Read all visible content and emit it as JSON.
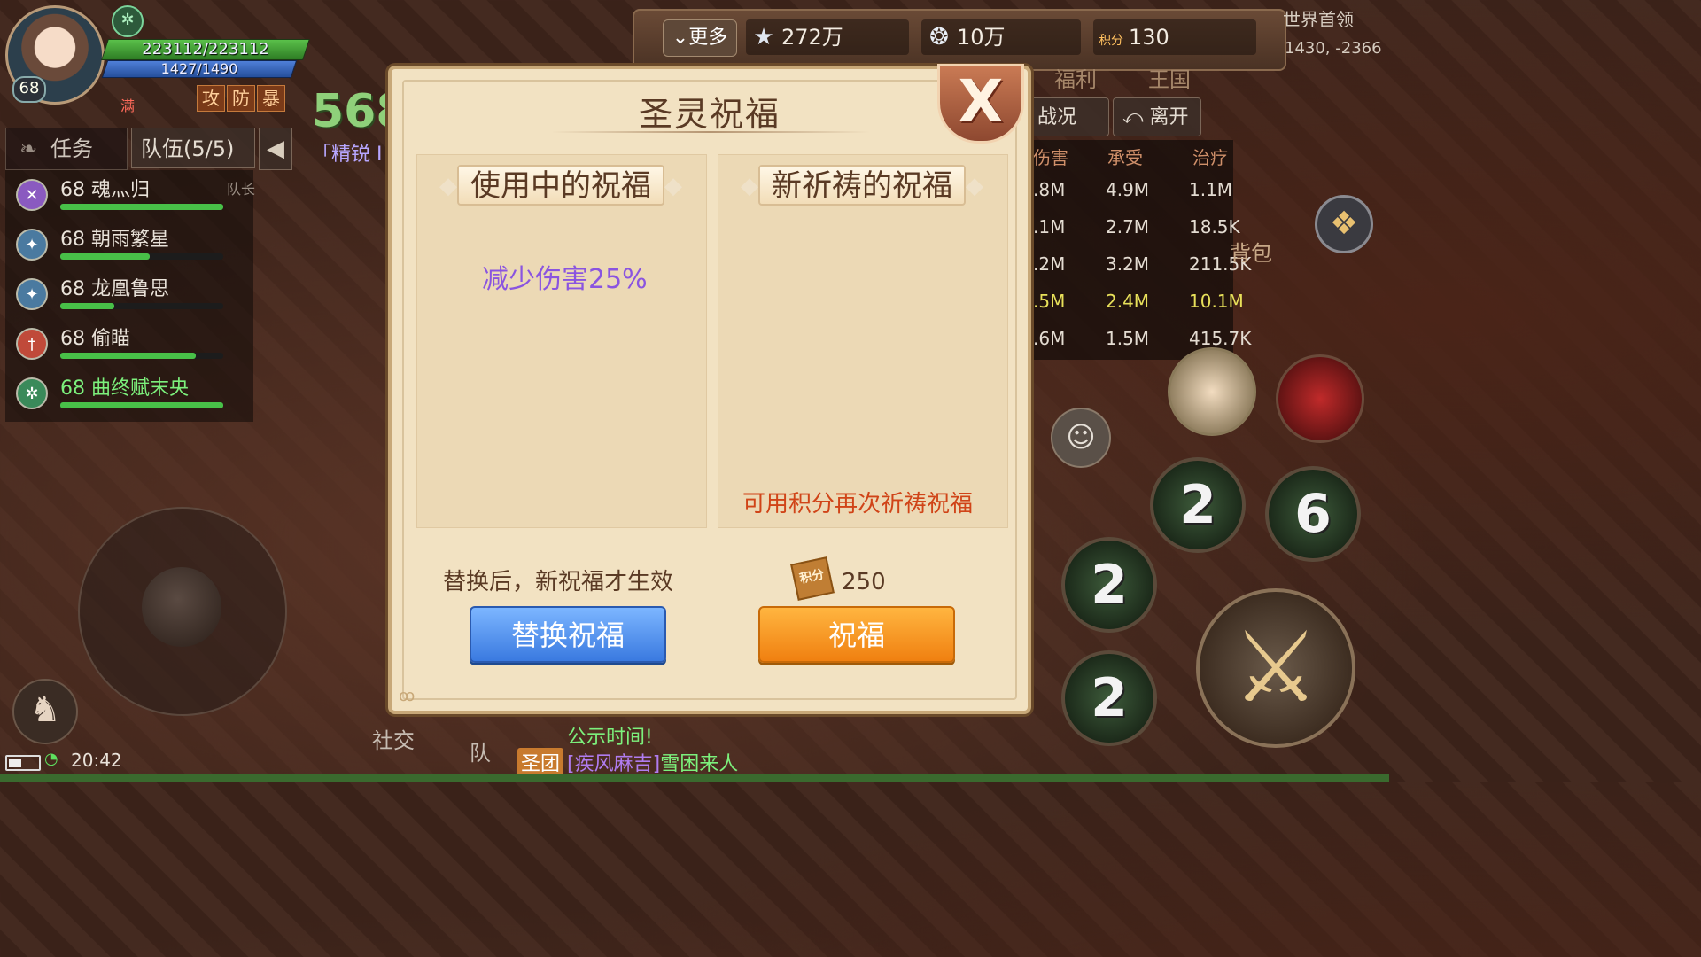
{
  "player": {
    "level": "68",
    "hp": "223112/223112",
    "mp": "1427/1490",
    "full_tag": "满",
    "stat_tags": [
      "攻",
      "防",
      "暴"
    ]
  },
  "left_tabs": {
    "task_label": "任务",
    "team_label": "队伍(5/5)"
  },
  "team": {
    "leader_tag": "队长",
    "members": [
      {
        "name": "68 魂灬归",
        "hp": 1.0,
        "color": "#8a5ac0"
      },
      {
        "name": "68 朝雨繁星",
        "hp": 0.55,
        "color": "#4a7aa0"
      },
      {
        "name": "68 龙凰鲁思",
        "hp": 0.33,
        "color": "#4a7aa0"
      },
      {
        "name": "68 偷瞄",
        "hp": 0.83,
        "color": "#c04a3a"
      },
      {
        "name": "68 曲终赋末央",
        "hp": 1.0,
        "color": "#3a8a5a"
      }
    ]
  },
  "background": {
    "number": "568",
    "elite": "「精锐 I"
  },
  "topbar": {
    "more_label": "更多",
    "star_value": "272万",
    "shell_value": "10万",
    "points_icon": "积分",
    "points_value": "130"
  },
  "world_boss": "世界首领",
  "coords": "1430, -2366",
  "right_menu": {
    "welfare": "福利",
    "kingdom": "王国",
    "battle_label": "战况",
    "leave_label": "离开",
    "bag": "背包"
  },
  "stats": {
    "headers": [
      "伤害",
      "承受",
      "治疗"
    ],
    "rows": [
      {
        "dmg": ".8M",
        "taken": "4.9M",
        "heal": "1.1M",
        "hl": false
      },
      {
        "dmg": ".1M",
        "taken": "2.7M",
        "heal": "18.5K",
        "hl": false
      },
      {
        "dmg": ".2M",
        "taken": "3.2M",
        "heal": "211.5K",
        "hl": false
      },
      {
        "dmg": ".5M",
        "taken": "2.4M",
        "heal": "10.1M",
        "hl": true
      },
      {
        "dmg": ".6M",
        "taken": "1.5M",
        "heal": "415.7K",
        "hl": false
      }
    ]
  },
  "skills": {
    "s1": "2",
    "s2": "6",
    "s3": "2",
    "s4": "2"
  },
  "footer": {
    "time": "20:42",
    "social": "社交",
    "team": "队",
    "chat1": "公示时间!",
    "chat2_tag": "圣团",
    "chat2_name": "[疾风麻吉]",
    "chat2_text": "雪困来人"
  },
  "dialog": {
    "title": "圣灵祝福",
    "close_label": "X",
    "col_active_title": "使用中的祝福",
    "col_new_title": "新祈祷的祝福",
    "active_blessing": "减少伤害25%",
    "reroll_hint": "可用积分再次祈祷祝福",
    "swap_hint": "替换后，新祝福才生效",
    "cost_icon": "积分",
    "cost_value": "250",
    "swap_button": "替换祝福",
    "bless_button": "祝福"
  }
}
